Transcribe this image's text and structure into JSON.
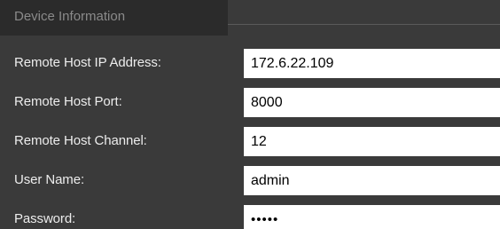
{
  "section": {
    "title": "Device Information"
  },
  "fields": [
    {
      "label": "Remote Host IP Address:",
      "value": "172.6.22.109"
    },
    {
      "label": "Remote Host Port:",
      "value": "8000"
    },
    {
      "label": "Remote Host Channel:",
      "value": "12"
    },
    {
      "label": "User Name:",
      "value": "admin"
    },
    {
      "label": "Password:",
      "value": "•••••"
    }
  ]
}
